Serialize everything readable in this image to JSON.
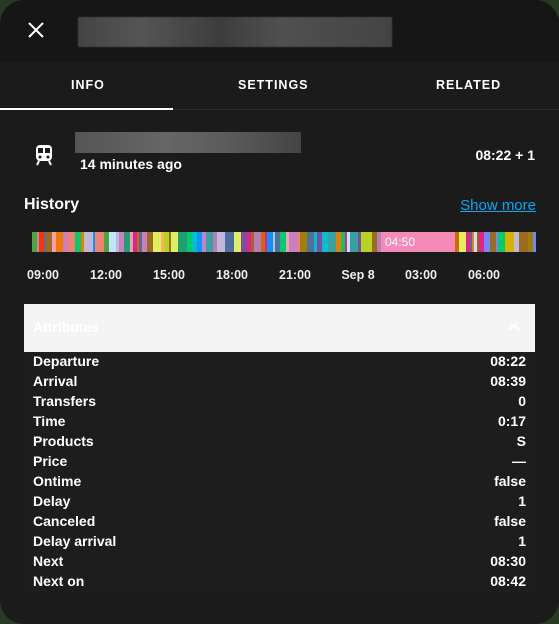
{
  "header": {
    "close_icon": "close-icon",
    "title": ""
  },
  "tabs": [
    {
      "label": "INFO",
      "active": true
    },
    {
      "label": "SETTINGS"
    },
    {
      "label": "RELATED"
    }
  ],
  "state": {
    "icon": "train-icon",
    "last_changed": "14 minutes ago",
    "value": "08:22 + 1"
  },
  "history": {
    "title": "History",
    "show_more": "Show more",
    "highlight_label": "04:50",
    "highlight_color": "#f589b7",
    "ticks": [
      "09:00",
      "12:00",
      "15:00",
      "18:00",
      "21:00",
      "Sep 8",
      "03:00",
      "06:00"
    ],
    "palette": [
      "#7b4fa0",
      "#f07a00",
      "#b8d31e",
      "#38a0a0",
      "#f08070",
      "#fdb068",
      "#c97fc2",
      "#c2e5ff",
      "#20a070",
      "#e91e8a",
      "#9c6b1e",
      "#0a94ff",
      "#00cc6a",
      "#ff3300",
      "#4aa83a",
      "#9a6a00",
      "#e0ef60",
      "#d8b000",
      "#a08000",
      "#b77dbb",
      "#f5a0b0",
      "#00c0d0",
      "#4f6fa0",
      "#6f88ff",
      "#d06a00",
      "#c0b8d8"
    ]
  },
  "attributes": {
    "title": "Attributes",
    "rows": [
      {
        "label": "Departure",
        "value": "08:22"
      },
      {
        "label": "Arrival",
        "value": "08:39"
      },
      {
        "label": "Transfers",
        "value": "0"
      },
      {
        "label": "Time",
        "value": "0:17"
      },
      {
        "label": "Products",
        "value": "S"
      },
      {
        "label": "Price",
        "value": "—"
      },
      {
        "label": "Ontime",
        "value": "false"
      },
      {
        "label": "Delay",
        "value": "1"
      },
      {
        "label": "Canceled",
        "value": "false"
      },
      {
        "label": "Delay arrival",
        "value": "1"
      },
      {
        "label": "Next",
        "value": "08:30"
      },
      {
        "label": "Next on",
        "value": "08:42"
      }
    ]
  }
}
